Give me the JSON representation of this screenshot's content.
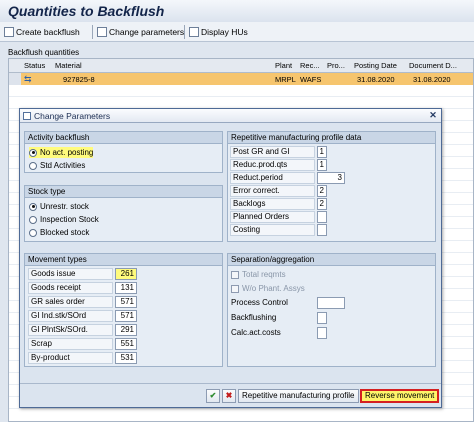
{
  "window": {
    "title": "Quantities to Backflush"
  },
  "toolbar": {
    "create_backflush": "Create backflush",
    "change_parameters": "Change parameters",
    "display_hus": "Display HUs"
  },
  "grid": {
    "title": "Backflush quantities",
    "columns": [
      "Status",
      "Material",
      "Plant",
      "Rec...",
      "Pro...",
      "Posting Date",
      "Document D..."
    ],
    "row": {
      "material": "927825-8",
      "plant": "MRPL",
      "recv": "WAFS",
      "posting_date": "31.08.2020",
      "document_date": "31.08.2020"
    }
  },
  "dialog": {
    "title": "Change Parameters",
    "activity": {
      "header": "Activity backflush",
      "options": [
        "No act. posting",
        "Std Activities"
      ],
      "selected": 0
    },
    "stock": {
      "header": "Stock type",
      "options": [
        "Unrestr. stock",
        "Inspection Stock",
        "Blocked stock"
      ],
      "selected": 0
    },
    "movement": {
      "header": "Movement types",
      "rows": [
        {
          "label": "Goods issue",
          "value": "261"
        },
        {
          "label": "Goods receipt",
          "value": "131"
        },
        {
          "label": "GR sales order",
          "value": "571"
        },
        {
          "label": "GI Ind.stk/SOrd",
          "value": "571"
        },
        {
          "label": "GI PlntSk/SOrd.",
          "value": "291"
        },
        {
          "label": "Scrap",
          "value": "551"
        },
        {
          "label": "By-product",
          "value": "531"
        }
      ]
    },
    "rem": {
      "header": "Repetitive manufacturing profile data",
      "rows": [
        {
          "label": "Post GR and GI",
          "value": "1"
        },
        {
          "label": "Reduc.prod.qts",
          "value": "1"
        },
        {
          "label": "Reduct.period",
          "value": "3"
        },
        {
          "label": "Error correct.",
          "value": "2"
        },
        {
          "label": "Backlogs",
          "value": "2"
        },
        {
          "label": "Planned Orders",
          "value": ""
        },
        {
          "label": "Costing",
          "value": ""
        }
      ]
    },
    "separation": {
      "header": "Separation/aggregation",
      "total_reqmts": "Total reqmts",
      "wo_phant": "W/o Phant. Assys",
      "process_control": "Process Control",
      "backflushing": "Backflushing",
      "calc_act_costs": "Calc.act.costs"
    },
    "footer": {
      "profile_button": "Repetitive manufacturing profile",
      "reverse_button": "Reverse movement"
    }
  }
}
